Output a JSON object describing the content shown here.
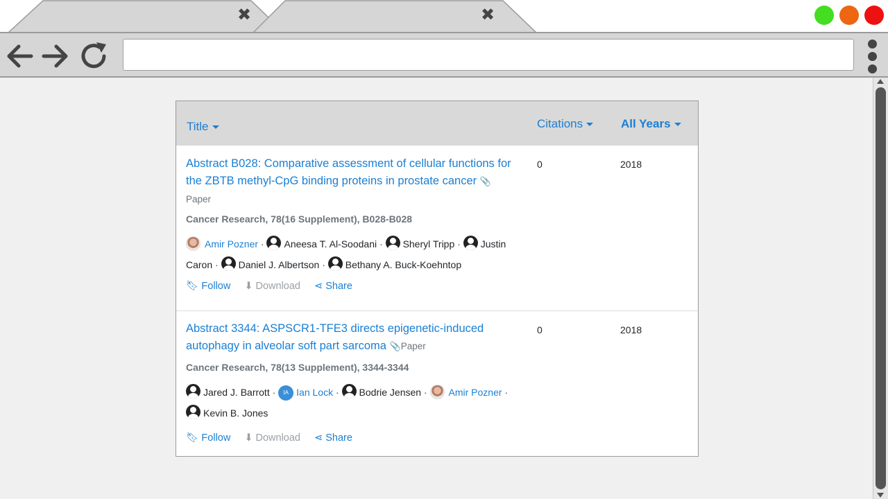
{
  "browser": {
    "tabs": [
      {
        "close_glyph": "✖"
      },
      {
        "close_glyph": "✖"
      }
    ],
    "window_controls": [
      "#44dd22",
      "#ee6611",
      "#ee1111"
    ],
    "url": ""
  },
  "table": {
    "headers": {
      "title": "Title",
      "citations": "Citations",
      "years": "All Years"
    },
    "rows": [
      {
        "title": "Abstract B028: Comparative assessment of cellular functions for the ZBTB methyl-CpG binding proteins in prostate cancer",
        "type": "Paper",
        "citations": "0",
        "year": "2018",
        "journal": "Cancer Research, 78(16 Supplement), B028-B028",
        "authors": [
          "Amir Pozner",
          "Aneesa T. Al-Soodani",
          "Sheryl Tripp",
          "Justin Caron",
          "Daniel J. Albertson",
          "Bethany A. Buck-Koehntop"
        ],
        "actions": {
          "follow": "Follow",
          "download": "Download",
          "share": "Share"
        }
      },
      {
        "title": "Abstract 3344: ASPSCR1-TFE3 directs epigenetic-induced autophagy in alveolar soft part sarcoma",
        "type": "Paper",
        "citations": "0",
        "year": "2018",
        "journal": "Cancer Research, 78(13 Supplement), 3344-3344",
        "authors": [
          "Jared J. Barrott",
          "Ian Lock",
          "Bodrie Jensen",
          "Amir Pozner",
          "Kevin B. Jones"
        ],
        "initials": "IA",
        "actions": {
          "follow": "Follow",
          "download": "Download",
          "share": "Share"
        }
      }
    ]
  },
  "colors": {
    "link": "#1a7fd4",
    "muted": "#6c757d",
    "header_bg": "#d9d9d9"
  },
  "icons": [
    "back-arrow-icon",
    "forward-arrow-icon",
    "reload-icon",
    "menu-dots-icon",
    "paperclip-icon",
    "bookmark-icon",
    "download-icon",
    "share-icon",
    "person-avatar-icon"
  ]
}
